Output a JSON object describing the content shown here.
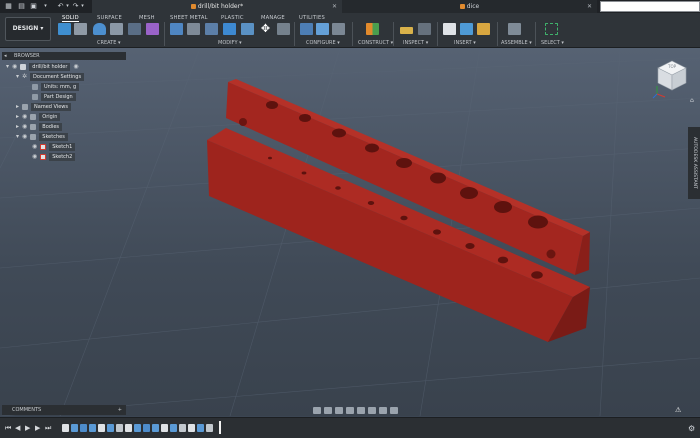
{
  "topbar": {
    "tabs": [
      {
        "title": "drill/bit holder*"
      },
      {
        "title": "dice"
      }
    ]
  },
  "ribbon": {
    "workspace": "DESIGN",
    "tabs": [
      "SOLID",
      "SURFACE",
      "MESH",
      "SHEET METAL",
      "PLASTIC",
      "MANAGE",
      "UTILITIES"
    ],
    "active_tab": "SOLID",
    "groups": [
      "CREATE ▾",
      "MODIFY ▾",
      "CONFIGURE ▾",
      "CONSTRUCT ▾",
      "INSPECT ▾",
      "INSERT ▾",
      "ASSEMBLE ▾",
      "SELECT ▾"
    ]
  },
  "browser": {
    "header": "BROWSER",
    "items": [
      {
        "label": "drill/bit holder"
      },
      {
        "label": "Document Settings"
      },
      {
        "label": "Units: mm, g"
      },
      {
        "label": "Part Design"
      },
      {
        "label": "Named Views"
      },
      {
        "label": "Origin"
      },
      {
        "label": "Bodies"
      },
      {
        "label": "Sketches"
      },
      {
        "label": "Sketch1"
      },
      {
        "label": "Sketch2"
      }
    ]
  },
  "assistant": {
    "label": "AUTODESK ASSISTANT"
  },
  "comments": {
    "label": "COMMENTS",
    "plus": "+"
  },
  "viewcube": {
    "top": "TOP"
  },
  "colors": {
    "model": "#a3261f",
    "model_dark": "#7a1b16",
    "accent": "#1e9bd7"
  }
}
